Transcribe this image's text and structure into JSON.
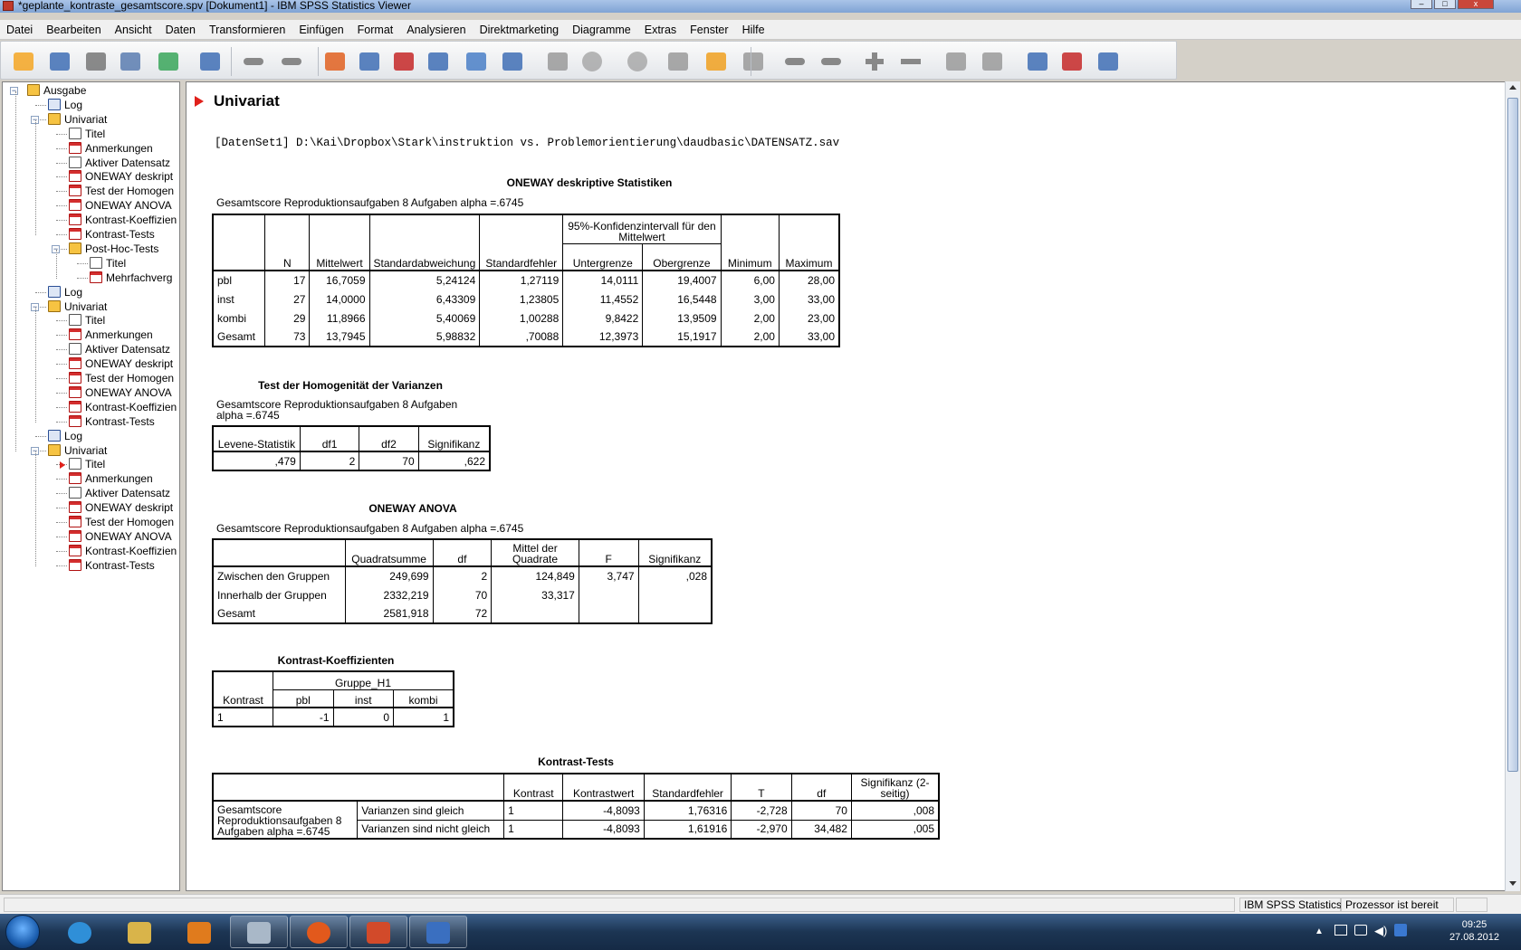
{
  "window": {
    "title": "*geplante_kontraste_gesamtscore.spv [Dokument1] - IBM SPSS Statistics Viewer"
  },
  "menu": [
    "Datei",
    "Bearbeiten",
    "Ansicht",
    "Daten",
    "Transformieren",
    "Einfügen",
    "Format",
    "Analysieren",
    "Direktmarketing",
    "Diagramme",
    "Extras",
    "Fenster",
    "Hilfe"
  ],
  "toolbar": {
    "buttons": [
      "open-icon",
      "save-icon",
      "print-icon",
      "print-preview-icon",
      "export-icon",
      "recall-dialog-icon",
      "undo-icon",
      "redo-icon",
      "goto-case-icon",
      "goto-variable-icon",
      "insert-cases-icon",
      "variables-icon",
      "split-file-icon",
      "weight-icon",
      "select-cases-icon",
      "value-labels-icon",
      "use-sets-icon",
      "show-all-icon",
      "spell-icon",
      "designate-window-icon",
      "back-icon",
      "forward-icon",
      "expand-icon",
      "collapse-icon",
      "show-icon",
      "hide-icon",
      "insert-heading-icon",
      "insert-title-icon",
      "insert-text-icon"
    ]
  },
  "outline": {
    "nodes": [
      {
        "label": "Ausgabe",
        "icon": "output-folder-icon",
        "level": 0
      },
      {
        "label": "Log",
        "icon": "log-icon",
        "level": 1
      },
      {
        "label": "Univariat",
        "icon": "procedure-folder-icon",
        "level": 1
      },
      {
        "label": "Titel",
        "icon": "title-icon",
        "level": 2
      },
      {
        "label": "Anmerkungen",
        "icon": "notes-icon",
        "level": 2
      },
      {
        "label": "Aktiver Datensatz",
        "icon": "text-icon",
        "level": 2
      },
      {
        "label": "ONEWAY deskript",
        "icon": "table-icon",
        "level": 2
      },
      {
        "label": "Test der Homogen",
        "icon": "table-icon",
        "level": 2
      },
      {
        "label": "ONEWAY ANOVA",
        "icon": "table-icon",
        "level": 2
      },
      {
        "label": "Kontrast-Koeffizien",
        "icon": "table-icon",
        "level": 2
      },
      {
        "label": "Kontrast-Tests",
        "icon": "table-icon",
        "level": 2
      },
      {
        "label": "Post-Hoc-Tests",
        "icon": "procedure-folder-icon",
        "level": 2
      },
      {
        "label": "Titel",
        "icon": "title-icon",
        "level": 3
      },
      {
        "label": "Mehrfachverg",
        "icon": "table-icon",
        "level": 3
      },
      {
        "label": "Log",
        "icon": "log-icon",
        "level": 1
      },
      {
        "label": "Univariat",
        "icon": "procedure-folder-icon",
        "level": 1
      },
      {
        "label": "Titel",
        "icon": "title-icon",
        "level": 2
      },
      {
        "label": "Anmerkungen",
        "icon": "notes-icon",
        "level": 2
      },
      {
        "label": "Aktiver Datensatz",
        "icon": "text-icon",
        "level": 2
      },
      {
        "label": "ONEWAY deskript",
        "icon": "table-icon",
        "level": 2
      },
      {
        "label": "Test der Homogen",
        "icon": "table-icon",
        "level": 2
      },
      {
        "label": "ONEWAY ANOVA",
        "icon": "table-icon",
        "level": 2
      },
      {
        "label": "Kontrast-Koeffizien",
        "icon": "table-icon",
        "level": 2
      },
      {
        "label": "Kontrast-Tests",
        "icon": "table-icon",
        "level": 2
      },
      {
        "label": "Log",
        "icon": "log-icon",
        "level": 1
      },
      {
        "label": "Univariat",
        "icon": "procedure-folder-icon",
        "level": 1
      },
      {
        "label": "Titel",
        "icon": "title-icon",
        "level": 2,
        "current": true
      },
      {
        "label": "Anmerkungen",
        "icon": "notes-icon",
        "level": 2
      },
      {
        "label": "Aktiver Datensatz",
        "icon": "text-icon",
        "level": 2
      },
      {
        "label": "ONEWAY deskript",
        "icon": "table-icon",
        "level": 2
      },
      {
        "label": "Test der Homogen",
        "icon": "table-icon",
        "level": 2
      },
      {
        "label": "ONEWAY ANOVA",
        "icon": "table-icon",
        "level": 2
      },
      {
        "label": "Kontrast-Koeffizien",
        "icon": "table-icon",
        "level": 2
      },
      {
        "label": "Kontrast-Tests",
        "icon": "table-icon",
        "level": 2
      }
    ]
  },
  "output": {
    "heading": "Univariat",
    "dataset": "[DatenSet1] D:\\Kai\\Dropbox\\Stark\\instruktion vs. Problemorientierung\\daudbasic\\DATENSATZ.sav",
    "descriptives": {
      "title": "ONEWAY deskriptive Statistiken",
      "subtitle": "Gesamtscore Reproduktionsaufgaben 8 Aufgaben alpha =.6745",
      "ci_header": "95%-Konfidenzintervall für den Mittelwert",
      "headers": [
        "N",
        "Mittelwert",
        "Standardabweichung",
        "Standardfehler",
        "Untergrenze",
        "Obergrenze",
        "Minimum",
        "Maximum"
      ],
      "rows": [
        {
          "label": "pbl",
          "cells": [
            "17",
            "16,7059",
            "5,24124",
            "1,27119",
            "14,0111",
            "19,4007",
            "6,00",
            "28,00"
          ]
        },
        {
          "label": "inst",
          "cells": [
            "27",
            "14,0000",
            "6,43309",
            "1,23805",
            "11,4552",
            "16,5448",
            "3,00",
            "33,00"
          ]
        },
        {
          "label": "kombi",
          "cells": [
            "29",
            "11,8966",
            "5,40069",
            "1,00288",
            "9,8422",
            "13,9509",
            "2,00",
            "23,00"
          ]
        },
        {
          "label": "Gesamt",
          "cells": [
            "73",
            "13,7945",
            "5,98832",
            ",70088",
            "12,3973",
            "15,1917",
            "2,00",
            "33,00"
          ]
        }
      ]
    },
    "homogeneity": {
      "title": "Test der Homogenität der Varianzen",
      "subtitle": "Gesamtscore Reproduktionsaufgaben 8 Aufgaben alpha =.6745",
      "headers": [
        "Levene-Statistik",
        "df1",
        "df2",
        "Signifikanz"
      ],
      "row": [
        ",479",
        "2",
        "70",
        ",622"
      ]
    },
    "anova": {
      "title": "ONEWAY ANOVA",
      "subtitle": "Gesamtscore Reproduktionsaufgaben 8 Aufgaben alpha =.6745",
      "headers": [
        "Quadratsumme",
        "df",
        "Mittel der Quadrate",
        "F",
        "Signifikanz"
      ],
      "rows": [
        {
          "label": "Zwischen den Gruppen",
          "cells": [
            "249,699",
            "2",
            "124,849",
            "3,747",
            ",028"
          ]
        },
        {
          "label": "Innerhalb der Gruppen",
          "cells": [
            "2332,219",
            "70",
            "33,317",
            "",
            ""
          ]
        },
        {
          "label": "Gesamt",
          "cells": [
            "2581,918",
            "72",
            "",
            "",
            ""
          ]
        }
      ]
    },
    "coefficients": {
      "title": "Kontrast-Koeffizienten",
      "row_header": "Kontrast",
      "group_header": "Gruppe_H1",
      "headers": [
        "pbl",
        "inst",
        "kombi"
      ],
      "row": {
        "label": "1",
        "cells": [
          "-1",
          "0",
          "1"
        ]
      }
    },
    "contrast_tests": {
      "title": "Kontrast-Tests",
      "headers": [
        "Kontrast",
        "Kontrastwert",
        "Standardfehler",
        "T",
        "df",
        "Signifikanz (2-seitig)"
      ],
      "variable": "Gesamtscore Reproduktionsaufgaben 8 Aufgaben alpha =.6745",
      "rows": [
        {
          "label": "Varianzen sind gleich",
          "cells": [
            "1",
            "-4,8093",
            "1,76316",
            "-2,728",
            "70",
            ",008"
          ]
        },
        {
          "label": "Varianzen sind nicht gleich",
          "cells": [
            "1",
            "-4,8093",
            "1,61916",
            "-2,970",
            "34,482",
            ",005"
          ]
        }
      ]
    }
  },
  "status": {
    "app": "IBM SPSS Statistics",
    "processor": "Prozessor ist bereit"
  },
  "taskbar": {
    "apps": [
      "windows-explorer-icon",
      "internet-explorer-icon",
      "file-explorer-icon",
      "media-player-icon",
      "calculator-icon",
      "firefox-icon",
      "presentation-icon",
      "spss-icon"
    ],
    "time": "09:25",
    "date": "27.08.2012"
  }
}
